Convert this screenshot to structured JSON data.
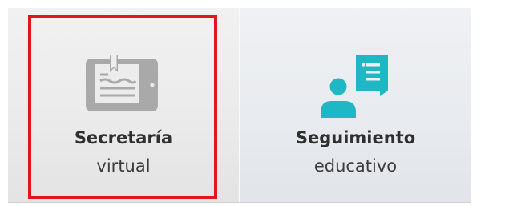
{
  "tiles": [
    {
      "title": "Secretaría",
      "subtitle": "virtual",
      "icon": "tablet-document-icon",
      "icon_color": "#a9a9a9",
      "selected": true
    },
    {
      "title": "Seguimiento",
      "subtitle": "educativo",
      "icon": "person-document-icon",
      "icon_color": "#1fb7c4",
      "selected": false
    }
  ],
  "colors": {
    "highlight": "#e0161e",
    "accent_teal": "#1fb7c4",
    "icon_gray": "#a9a9a9",
    "text": "#333333"
  }
}
